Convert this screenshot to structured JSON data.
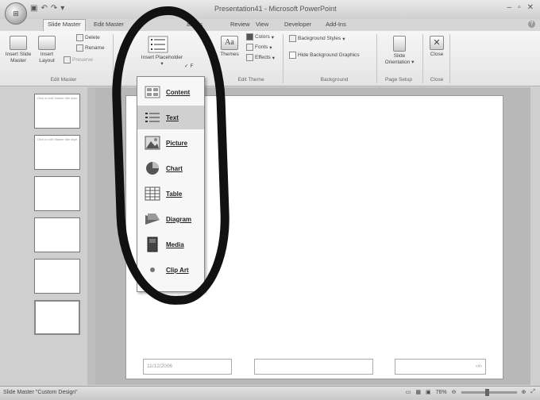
{
  "window": {
    "title": "Presentation41 - Microsoft PowerPoint"
  },
  "tabs": [
    "Slide Master",
    "Edit Master",
    "Review",
    "View",
    "Developer",
    "Add-Ins"
  ],
  "tabs_partial": {
    "obscured": "ations"
  },
  "ribbon": {
    "edit_master": {
      "insert_slide_master": "Insert Slide Master",
      "insert_layout": "Insert Layout",
      "delete": "Delete",
      "rename": "Rename",
      "preserve": "Preserve",
      "group_label": "Edit Master"
    },
    "master_layout": {
      "insert_placeholder": "Insert Placeholder",
      "footers_partial": "F"
    },
    "edit_theme": {
      "themes": "Themes",
      "colors": "Colors",
      "fonts": "Fonts",
      "effects": "Effects",
      "group_label": "Edit Theme"
    },
    "background": {
      "background_styles": "Background Styles",
      "hide_background_graphics": "Hide Background Graphics",
      "group_label": "Background"
    },
    "page_setup": {
      "slide_orientation": "Slide Orientation",
      "group_label": "Page Setup"
    },
    "close": {
      "close": "Close",
      "group_label": "Close"
    }
  },
  "dropdown": {
    "items": [
      "Content",
      "Text",
      "Picture",
      "Chart",
      "Table",
      "Diagram",
      "Media",
      "Clip Art"
    ],
    "highlighted": "Text"
  },
  "thumbnails": {
    "title_text": "Click to edit Master title style"
  },
  "slide": {
    "date_placeholder": "11/12/2006",
    "page_number_placeholder": "‹#›"
  },
  "statusbar": {
    "left": "Slide Master   \"Custom Design\"",
    "zoom": "76%"
  },
  "colors": {
    "marker": "#111111",
    "ribbon": "#e9e9e9",
    "highlight_row": "#d0d0d0"
  }
}
